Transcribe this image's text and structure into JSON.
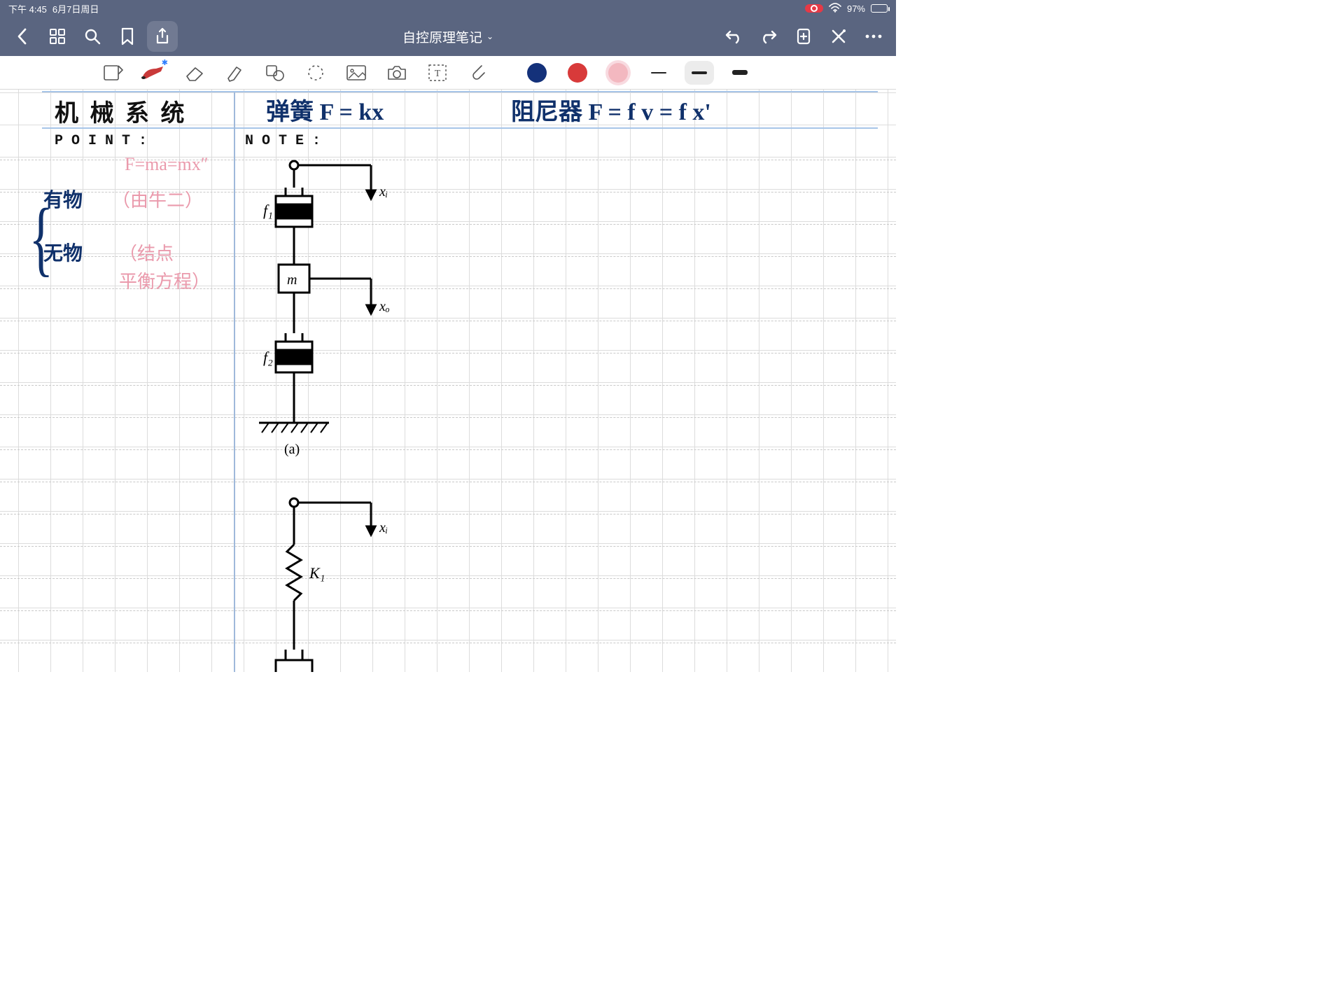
{
  "status": {
    "time": "下午 4:45",
    "date": "6月7日周日",
    "battery": "97%"
  },
  "nav": {
    "title": "自控原理笔记"
  },
  "page": {
    "section_title": "机 械 系 统",
    "point_label": "POINT:",
    "note_label": "NOTE:",
    "formula_spring": "弹簧  F = kx",
    "formula_damper": "阻尼器  F = f v = f x'",
    "newton": "F=ma=mx″",
    "has_mass": "有物",
    "has_mass_hint": "（由牛二）",
    "no_mass": "无物",
    "no_mass_hint1": "（结点",
    "no_mass_hint2": "平衡方程）",
    "dia_a": {
      "f1": "f₁",
      "m": "m",
      "f2": "f₂",
      "xi": "xᵢ",
      "xo": "xₒ",
      "caption": "(a)"
    },
    "dia_b": {
      "k1": "K₁",
      "xi": "xᵢ"
    }
  }
}
